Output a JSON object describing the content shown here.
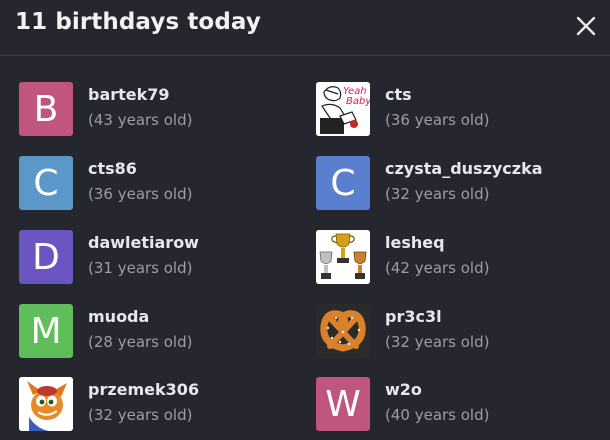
{
  "modal": {
    "title": "11 birthdays today",
    "close_icon": "close-icon"
  },
  "colors": {
    "background": "#25262e",
    "divider": "#3a3b45",
    "name_text": "#e6e7ee",
    "age_text": "#9b9ca6"
  },
  "users": {
    "left": [
      {
        "name": "bartek79",
        "age": "(43 years old)",
        "avatar_letter": "B",
        "avatar_color": "#c0567f"
      },
      {
        "name": "cts86",
        "age": "(36 years old)",
        "avatar_letter": "C",
        "avatar_color": "#5b97c9"
      },
      {
        "name": "dawletiarow",
        "age": "(31 years old)",
        "avatar_letter": "D",
        "avatar_color": "#6a55c2"
      },
      {
        "name": "muoda",
        "age": "(28 years old)",
        "avatar_letter": "M",
        "avatar_color": "#5fbd5a"
      },
      {
        "name": "przemek306",
        "age": "(32 years old)",
        "avatar_letter": "",
        "avatar_color": "#ffffff",
        "avatar_icon": "crash-bandicoot-avatar"
      }
    ],
    "right": [
      {
        "name": "cts",
        "age": "(36 years old)",
        "avatar_letter": "",
        "avatar_color": "#ffffff",
        "avatar_icon": "yeah-baby-avatar",
        "avatar_text": "Yeah Baby"
      },
      {
        "name": "czysta_duszyczka",
        "age": "(32 years old)",
        "avatar_letter": "C",
        "avatar_color": "#5b7fcf"
      },
      {
        "name": "lesheq",
        "age": "(42 years old)",
        "avatar_letter": "",
        "avatar_color": "#ffffff",
        "avatar_icon": "trophies-avatar"
      },
      {
        "name": "pr3c3l",
        "age": "(32 years old)",
        "avatar_letter": "",
        "avatar_color": "#2b2b2b",
        "avatar_icon": "pretzel-avatar"
      },
      {
        "name": "w2o",
        "age": "(40 years old)",
        "avatar_letter": "W",
        "avatar_color": "#c0567f"
      }
    ]
  }
}
